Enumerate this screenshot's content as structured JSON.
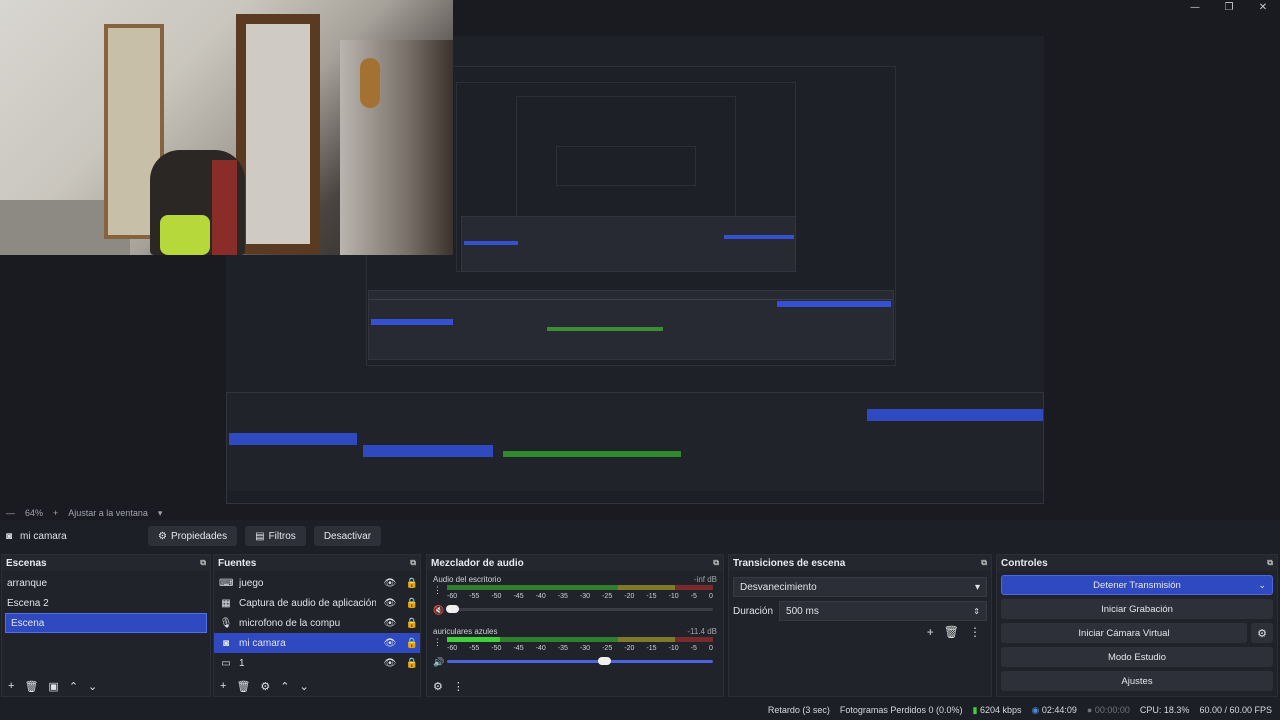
{
  "window": {
    "controls": [
      "—",
      "❐",
      "✕"
    ]
  },
  "preview": {
    "zoom": "64%",
    "fit_label": "Ajustar a la ventana"
  },
  "toolbar": {
    "source_name": "mi camara",
    "properties_label": "Propiedades",
    "filters_label": "Filtros",
    "deactivate_label": "Desactivar"
  },
  "scenes": {
    "title": "Escenas",
    "items": [
      "arranque",
      "Escena 2",
      "Escena"
    ],
    "selected": "Escena"
  },
  "sources": {
    "title": "Fuentes",
    "items": [
      {
        "name": "juego",
        "icon": "gamepad-icon"
      },
      {
        "name": "Captura de audio de aplicación (BETA)",
        "icon": "app-audio-icon"
      },
      {
        "name": "microfono de la compu",
        "icon": "microphone-icon"
      },
      {
        "name": "mi camara",
        "icon": "camera-icon",
        "selected": true
      },
      {
        "name": "1",
        "icon": "display-icon"
      }
    ]
  },
  "mixer": {
    "title": "Mezclador de audio",
    "scale": [
      "-60",
      "-55",
      "-50",
      "-45",
      "-40",
      "-35",
      "-30",
      "-25",
      "-20",
      "-15",
      "-10",
      "-5",
      "0"
    ],
    "channels": [
      {
        "name": "Audio del escritorio",
        "db": "-inf dB",
        "level": 0.0,
        "volume": 0.02,
        "muted": true
      },
      {
        "name": "auriculares azules",
        "db": "-11.4 dB",
        "level": 0.2,
        "volume": 0.59,
        "muted": false
      }
    ]
  },
  "transitions": {
    "title": "Transiciones de escena",
    "selected": "Desvanecimiento",
    "duration_label": "Duración",
    "duration_value": "500 ms"
  },
  "controls": {
    "title": "Controles",
    "stop_stream": "Detener Transmisión",
    "start_recording": "Iniciar Grabación",
    "start_virtual_cam": "Iniciar Cámara Virtual",
    "studio_mode": "Modo Estudio",
    "settings": "Ajustes"
  },
  "status": {
    "delay": "Retardo (3 sec)",
    "dropped_frames": "Fotogramas Perdidos 0 (0.0%)",
    "bitrate": "6204 kbps",
    "stream_time": "02:44:09",
    "record_time": "00:00:00",
    "cpu": "CPU: 18.3%",
    "fps": "60.00 / 60.00 FPS"
  }
}
